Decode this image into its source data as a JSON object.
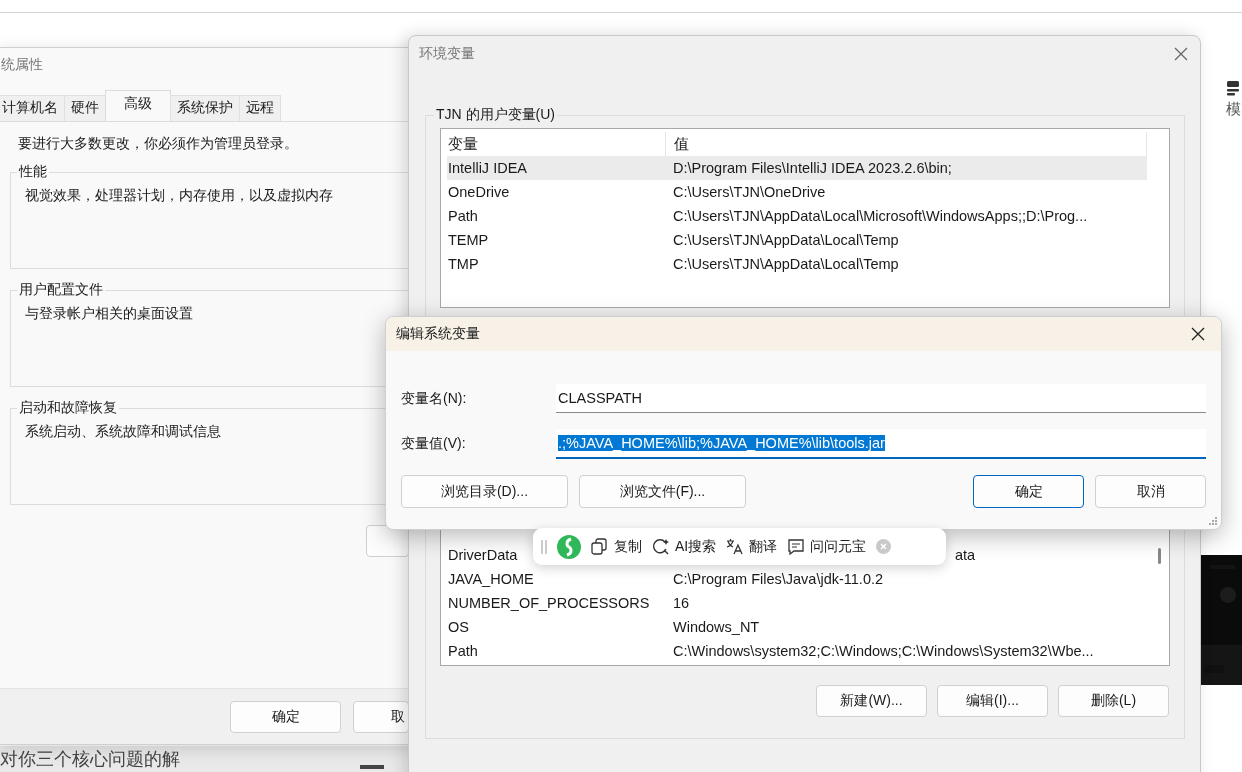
{
  "page": {
    "side_label": "模",
    "footer_text": "对你三个核心问题的解"
  },
  "system_properties": {
    "title": "统属性",
    "tabs": [
      {
        "label": "计算机名",
        "selected": false
      },
      {
        "label": "硬件",
        "selected": false
      },
      {
        "label": "高级",
        "selected": true
      },
      {
        "label": "系统保护",
        "selected": false
      },
      {
        "label": "远程",
        "selected": false
      }
    ],
    "notice": "要进行大多数更改，你必须作为管理员登录。",
    "groups": [
      {
        "title": "性能",
        "description": "视觉效果，处理器计划，内存使用，以及虚拟内存"
      },
      {
        "title": "用户配置文件",
        "description": "与登录帐户相关的桌面设置"
      },
      {
        "title": "启动和故障恢复",
        "description": "系统启动、系统故障和调试信息"
      }
    ],
    "buttons": [
      "确定",
      "取"
    ]
  },
  "environment_variables": {
    "title": "环境变量",
    "user_group": {
      "title": "TJN 的用户变量(U)",
      "columns": [
        "变量",
        "值"
      ],
      "rows": [
        {
          "name": "IntelliJ IDEA",
          "value": "D:\\Program Files\\IntelliJ IDEA 2023.2.6\\bin;",
          "selected": true
        },
        {
          "name": "OneDrive",
          "value": "C:\\Users\\TJN\\OneDrive",
          "selected": false
        },
        {
          "name": "Path",
          "value": "C:\\Users\\TJN\\AppData\\Local\\Microsoft\\WindowsApps;;D:\\Prog...",
          "selected": false
        },
        {
          "name": "TEMP",
          "value": "C:\\Users\\TJN\\AppData\\Local\\Temp",
          "selected": false
        },
        {
          "name": "TMP",
          "value": "C:\\Users\\TJN\\AppData\\Local\\Temp",
          "selected": false
        }
      ]
    },
    "system_group": {
      "rows": [
        {
          "name": "DriverData",
          "value": "ata",
          "selected": false
        },
        {
          "name": "JAVA_HOME",
          "value": "C:\\Program Files\\Java\\jdk-11.0.2",
          "selected": false
        },
        {
          "name": "NUMBER_OF_PROCESSORS",
          "value": "16",
          "selected": false
        },
        {
          "name": "OS",
          "value": "Windows_NT",
          "selected": false
        },
        {
          "name": "Path",
          "value": "C:\\Windows\\system32;C:\\Windows;C:\\Windows\\System32\\Wbe...",
          "selected": false
        }
      ],
      "buttons": [
        "新建(W)...",
        "编辑(I)...",
        "删除(L)"
      ]
    }
  },
  "edit_dialog": {
    "title": "编辑系统变量",
    "fields": [
      {
        "label": "变量名(N):",
        "value": "CLASSPATH",
        "text_selected": false
      },
      {
        "label": "变量值(V):",
        "value": ".;%JAVA_HOME%\\lib;%JAVA_HOME%\\lib\\tools.jar",
        "text_selected": true
      }
    ],
    "buttons": [
      {
        "label": "浏览目录(D)...",
        "default": false
      },
      {
        "label": "浏览文件(F)...",
        "default": false
      },
      {
        "label": "确定",
        "default": true
      },
      {
        "label": "取消",
        "default": false
      }
    ]
  },
  "selection_toolbar": {
    "items": [
      {
        "kind": "copy",
        "label": "复制"
      },
      {
        "kind": "search",
        "label": "AI搜索"
      },
      {
        "kind": "translate",
        "label": "翻译"
      },
      {
        "kind": "ask",
        "label": "问问元宝"
      }
    ]
  }
}
